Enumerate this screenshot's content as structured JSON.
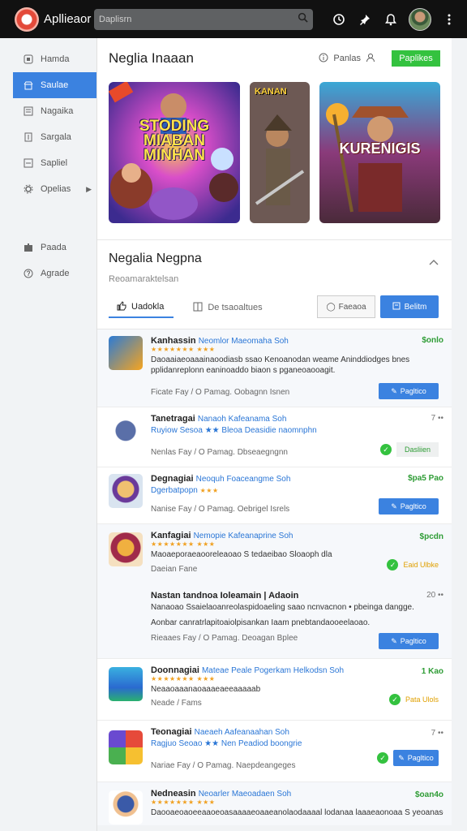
{
  "topbar": {
    "app_title": "Apllieaor",
    "search_placeholder": "Daplisrn",
    "icons": [
      "logo-icon",
      "search-icon",
      "clock-icon",
      "pin-icon",
      "bell-icon",
      "avatar",
      "more-icon"
    ]
  },
  "sidebar": {
    "items": [
      {
        "label": "Hamda",
        "icon": "home-icon"
      },
      {
        "label": "Saulae",
        "icon": "store-icon",
        "active": true
      },
      {
        "label": "Nagaika",
        "icon": "book-icon"
      },
      {
        "label": "Sargala",
        "icon": "doc-icon"
      },
      {
        "label": "Sapliel",
        "icon": "list-icon"
      },
      {
        "label": "Opelias",
        "icon": "settings-icon",
        "has_submenu": true
      },
      {
        "label": "Paada",
        "icon": "puzzle-icon"
      },
      {
        "label": "Agrade",
        "icon": "help-icon"
      }
    ]
  },
  "main": {
    "title": "Neglia Inaaan",
    "header_link": "Panlas",
    "header_button": "Paplikes",
    "banners": [
      {
        "text": "STODING MIABAN MINHAN"
      },
      {
        "text": "KANAN"
      },
      {
        "text": "KURENIGIS"
      }
    ],
    "section": {
      "title": "Negalia Negpna",
      "subtitle": "Reoamaraktelsan",
      "tab_active": "Uadokla",
      "tab_inactive": "De tsaoaltues",
      "btn_outline": "Faeaoa",
      "btn_primary": "Belitm"
    }
  },
  "list": [
    {
      "name": "Kanhassin",
      "sub": "Neomlor Maeomaha Soh",
      "price": "$onlo",
      "desc": "Daoaaiaeoaaainaoodiasb ssao Kenoanodan weame Aninddiodges bnes pplidanreplonn eaninoaddo biaon s pganeoaooagit.",
      "meta": "Ficate Fay / O Pamag. Oobagnn Isnen",
      "action": "Pagltico",
      "action_type": "button",
      "icon": "game-icon-blue"
    },
    {
      "name": "Tanetragai",
      "sub": "Nanaoh Kafeanama Soh",
      "price": "7 ••",
      "price_gray": true,
      "sub2": "Ruyiow Sesoa ★★ Bleoa   Deasidie naomnphn",
      "meta": "Nenlas Fay / O Pamag. Dbseaegngnn",
      "action": "Dasliien",
      "action_type": "installed",
      "icon": "game-icon-gray"
    },
    {
      "name": "Degnagiai",
      "sub": "Neoquh Foaceangme Soh",
      "price": "$pa5 Pao",
      "sub2": "Dgerbatpopn",
      "meta": "Nanise Fay / O Pamag. Oebrigel Isrels",
      "action": "Pagltico",
      "action_type": "button",
      "icon": "game-icon-hat"
    },
    {
      "name": "Kanfagiai",
      "sub": "Nemopie Kafeanaprine Soh",
      "price": "$pcdn",
      "desc": "Maoaeporaeaooreleaoao S tedaeibao Sloaoph dla",
      "meta": "Daeian Fane",
      "action": "Eaid Ulbke",
      "action_type": "installed",
      "icon": "game-icon-knight"
    },
    {
      "name": "Nastan tandnoa Ioleamain | Adaoin",
      "sub": "",
      "price": "20 ••",
      "price_gray": true,
      "desc": "Nanaoao Ssaielaoanreolaspidoaeling saao ncnvacnon • pbeinga dangge.",
      "desc2": "Aonbar canratrlapitoaiolpisankan Iaam pnebtandaooeelaoao.",
      "meta": "Rieaaes Fay / O Pamag. Deoagan Bplee",
      "action": "Pagltico",
      "action_type": "button",
      "icon": ""
    },
    {
      "name": "Doonnagiai",
      "sub": "Mateae Peale Pogerkam Helkodsn Soh",
      "price": "1 Kao",
      "sub2": "Neaaoaaanaoaaaeaeeaaaaab",
      "meta": "Neade / Fams",
      "action": "Pata Ulols",
      "action_type": "installed",
      "icon": "game-icon-castle"
    },
    {
      "name": "Teonagiai",
      "sub": "Naeaeh Aafeanaahan Soh",
      "price": "7 ••",
      "price_gray": true,
      "sub2": "Ragjuo Seoao ★★ Nen   Peadiod boongrie",
      "meta": "Nariae Fay / O Pamag. Naepdeangeges",
      "action": "Pagltico",
      "action_type": "installed-button",
      "icon": "game-icon-gems"
    },
    {
      "name": "Nedneasin",
      "sub": "Neoarler Maeoadaen Soh",
      "price": "$oan4o",
      "desc": "Daooaeoaoeeaaoeoasaaaaeoaaeanolaodaaaal lodanaa laaaeaonoaa S yeoanaseoo.",
      "meta": "",
      "action": "",
      "action_type": "none",
      "icon": "game-icon-pirate"
    }
  ]
}
